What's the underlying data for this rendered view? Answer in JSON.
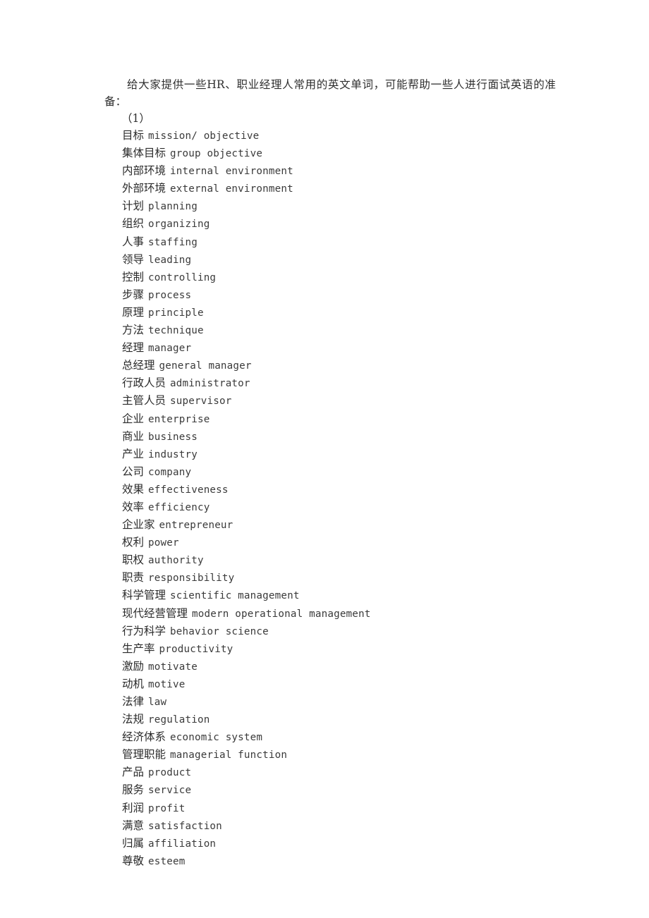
{
  "document": {
    "intro_paragraph": "给大家提供一些HR、职业经理人常用的英文单词，可能帮助一些人进行面试英语的准备：",
    "section_number": "（1）",
    "entries": [
      {
        "cn": "目标",
        "en": "mission/ objective"
      },
      {
        "cn": "集体目标",
        "en": "group objective"
      },
      {
        "cn": "内部环境",
        "en": "internal environment"
      },
      {
        "cn": "外部环境",
        "en": "external environment"
      },
      {
        "cn": "计划",
        "en": "planning"
      },
      {
        "cn": "组织",
        "en": "organizing"
      },
      {
        "cn": "人事",
        "en": "staffing"
      },
      {
        "cn": "领导",
        "en": "leading"
      },
      {
        "cn": "控制",
        "en": "controlling"
      },
      {
        "cn": "步骤",
        "en": "process"
      },
      {
        "cn": "原理",
        "en": "principle"
      },
      {
        "cn": "方法",
        "en": "technique"
      },
      {
        "cn": "经理",
        "en": "manager"
      },
      {
        "cn": "总经理",
        "en": "general manager"
      },
      {
        "cn": "行政人员",
        "en": "administrator"
      },
      {
        "cn": "主管人员",
        "en": "supervisor"
      },
      {
        "cn": "企业",
        "en": "enterprise"
      },
      {
        "cn": "商业",
        "en": "business"
      },
      {
        "cn": "产业",
        "en": "industry"
      },
      {
        "cn": "公司",
        "en": "company"
      },
      {
        "cn": "效果",
        "en": "effectiveness"
      },
      {
        "cn": "效率",
        "en": "efficiency"
      },
      {
        "cn": "企业家",
        "en": "entrepreneur"
      },
      {
        "cn": "权利",
        "en": "power"
      },
      {
        "cn": "职权",
        "en": "authority"
      },
      {
        "cn": "职责",
        "en": "responsibility"
      },
      {
        "cn": "科学管理",
        "en": "scientific management"
      },
      {
        "cn": "现代经营管理",
        "en": "modern operational management"
      },
      {
        "cn": "行为科学",
        "en": "behavior science"
      },
      {
        "cn": "生产率",
        "en": "productivity"
      },
      {
        "cn": "激励",
        "en": "motivate"
      },
      {
        "cn": "动机",
        "en": "motive"
      },
      {
        "cn": "法律",
        "en": "law"
      },
      {
        "cn": "法规",
        "en": "regulation"
      },
      {
        "cn": "经济体系",
        "en": "economic system"
      },
      {
        "cn": "管理职能",
        "en": "managerial function"
      },
      {
        "cn": "产品",
        "en": "product"
      },
      {
        "cn": "服务",
        "en": "service"
      },
      {
        "cn": "利润",
        "en": "profit"
      },
      {
        "cn": "满意",
        "en": "satisfaction"
      },
      {
        "cn": "归属",
        "en": "affiliation"
      },
      {
        "cn": "尊敬",
        "en": "esteem"
      }
    ]
  }
}
